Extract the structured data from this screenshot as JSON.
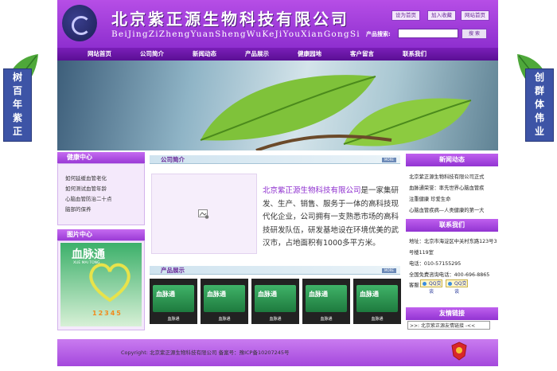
{
  "header": {
    "company_name": "北京紫正源生物科技有限公司",
    "company_pinyin": "BeiJingZiZhengYuanShengWuKeJiYouXianGongSi",
    "links": [
      "设为首页",
      "加入收藏",
      "网站首页"
    ],
    "search_label": "产品搜索:",
    "search_value": "",
    "search_button": "搜 索"
  },
  "nav": [
    "网站首页",
    "公司简介",
    "新闻动态",
    "产品展示",
    "健康园地",
    "客户留言",
    "联系我们"
  ],
  "side_left": "树百年紫正",
  "side_right": "创群体伟业",
  "left": {
    "health_title": "健康中心",
    "health_items": [
      "如何延缓血管老化",
      "如何测试血管年龄",
      "心脑血管防治二十点",
      "脑部的保养"
    ],
    "gallery_title": "图片中心",
    "gallery_product": "血脉通",
    "gallery_sub": "XUE MAI TONG",
    "gallery_nums": "12345"
  },
  "center": {
    "about_title": "公司简介",
    "more": "MORE",
    "about_company": "北京紫正源生物科技有限公司",
    "about_text": "是一家集研发、生产、销售、服务于一体的高科技现代化企业，公司拥有一支熟悉市场的高科技研发队伍，研发基地设在环境优美的武汉市，占地面积有1000多平方米。",
    "products_title": "产品展示",
    "products": [
      {
        "label": "血脉通",
        "caption": "血脉通"
      },
      {
        "label": "血脉通",
        "caption": "血脉通"
      },
      {
        "label": "血脉通",
        "caption": "血脉通"
      },
      {
        "label": "血脉通",
        "caption": "血脉通"
      },
      {
        "label": "血脉通",
        "caption": "血脉通"
      }
    ]
  },
  "right": {
    "news_title": "新闻动态",
    "news_items": [
      "北京紫正源生物科技有限公司正式",
      "血脉通荣誉：率先世界心脑血管疾",
      "注重健康 珍爱生命",
      "心脑血管疾病—人类健康的第一大"
    ],
    "contact_title": "联系我们",
    "address": "地址：北京市海淀区中关村东路123号3",
    "address2": "号楼119室",
    "phone": "电话：010-57155295",
    "hotline": "全国免费咨询电话：400-696-8865",
    "qq_prefix": "客服：",
    "qq_label": "QQ交谈",
    "friend_title": "友情链接",
    "friend_select": ">>: 北京紫正源友情链接 -<<"
  },
  "footer": {
    "copyright": "Copyright: 北京紫正源生物科技有限公司  备案号：豫ICP备10207245号"
  },
  "colors": {
    "brand": "#8e2fcf",
    "nav": "#5a0f94",
    "accent": "#3d54a6"
  }
}
